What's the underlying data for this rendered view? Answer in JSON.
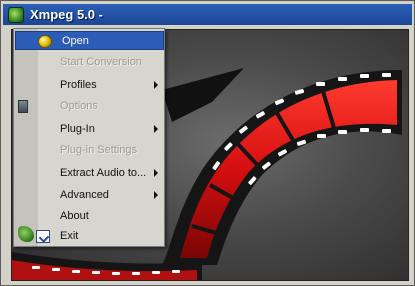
{
  "window": {
    "title": "Xmpeg 5.0 -"
  },
  "menu": {
    "items": [
      {
        "label": "Open",
        "enabled": true,
        "highlighted": true,
        "submenu": false,
        "icon": "open-icon"
      },
      {
        "label": "Start Conversion",
        "enabled": false,
        "submenu": false
      },
      {
        "label": "Profiles",
        "enabled": true,
        "submenu": true
      },
      {
        "label": "Options",
        "enabled": false,
        "submenu": false,
        "icon": "options-icon"
      },
      {
        "label": "Plug-In",
        "enabled": true,
        "submenu": true
      },
      {
        "label": "Plug-in Settings",
        "enabled": false,
        "submenu": false
      },
      {
        "label": "Extract Audio to...",
        "enabled": true,
        "submenu": true
      },
      {
        "label": "Advanced",
        "enabled": true,
        "submenu": true
      },
      {
        "label": "About",
        "enabled": true,
        "submenu": false
      },
      {
        "label": "Exit",
        "enabled": true,
        "submenu": false,
        "icon": "exit-icon"
      }
    ]
  },
  "colors": {
    "titlebar": "#1d4596",
    "highlight": "#2b5cb6",
    "film_red": "#e01818",
    "menu_bg": "#d6d6cf"
  }
}
